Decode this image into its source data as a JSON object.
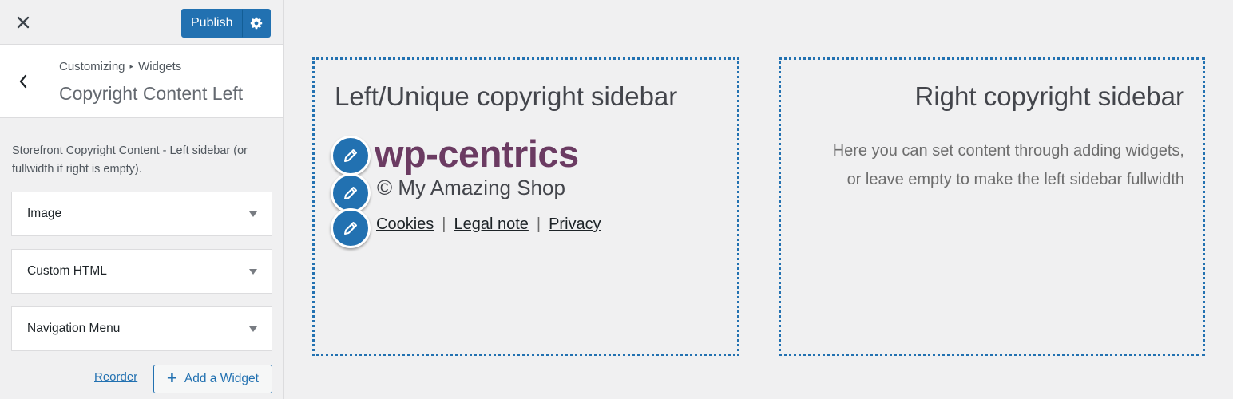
{
  "topbar": {
    "close_icon": "close-icon",
    "publish_label": "Publish",
    "settings_icon": "gear-icon"
  },
  "section": {
    "back_icon": "chevron-left-icon",
    "breadcrumb": [
      "Customizing",
      "Widgets"
    ],
    "title": "Copyright Content Left",
    "description": "Storefront Copyright Content - Left sidebar (or fullwidth if right is empty)."
  },
  "widgets": [
    {
      "title": "Image"
    },
    {
      "title": "Custom HTML"
    },
    {
      "title": "Navigation Menu"
    }
  ],
  "actions": {
    "reorder_label": "Reorder",
    "add_widget_label": "Add a Widget"
  },
  "preview": {
    "left_title": "Left/Unique copyright sidebar",
    "brand_text": "wp-centrics",
    "copyright_text": "© My Amazing Shop",
    "links": [
      "Cookies",
      "Legal note",
      "Privacy"
    ],
    "link_separator": "|",
    "right_title": "Right copyright sidebar",
    "right_desc_line1": "Here you can set content through adding widgets,",
    "right_desc_line2": "or leave empty to make the left sidebar fullwidth"
  },
  "colors": {
    "accent": "#2271b1",
    "brand": "#6b3b62",
    "background": "#f0f0f1"
  }
}
